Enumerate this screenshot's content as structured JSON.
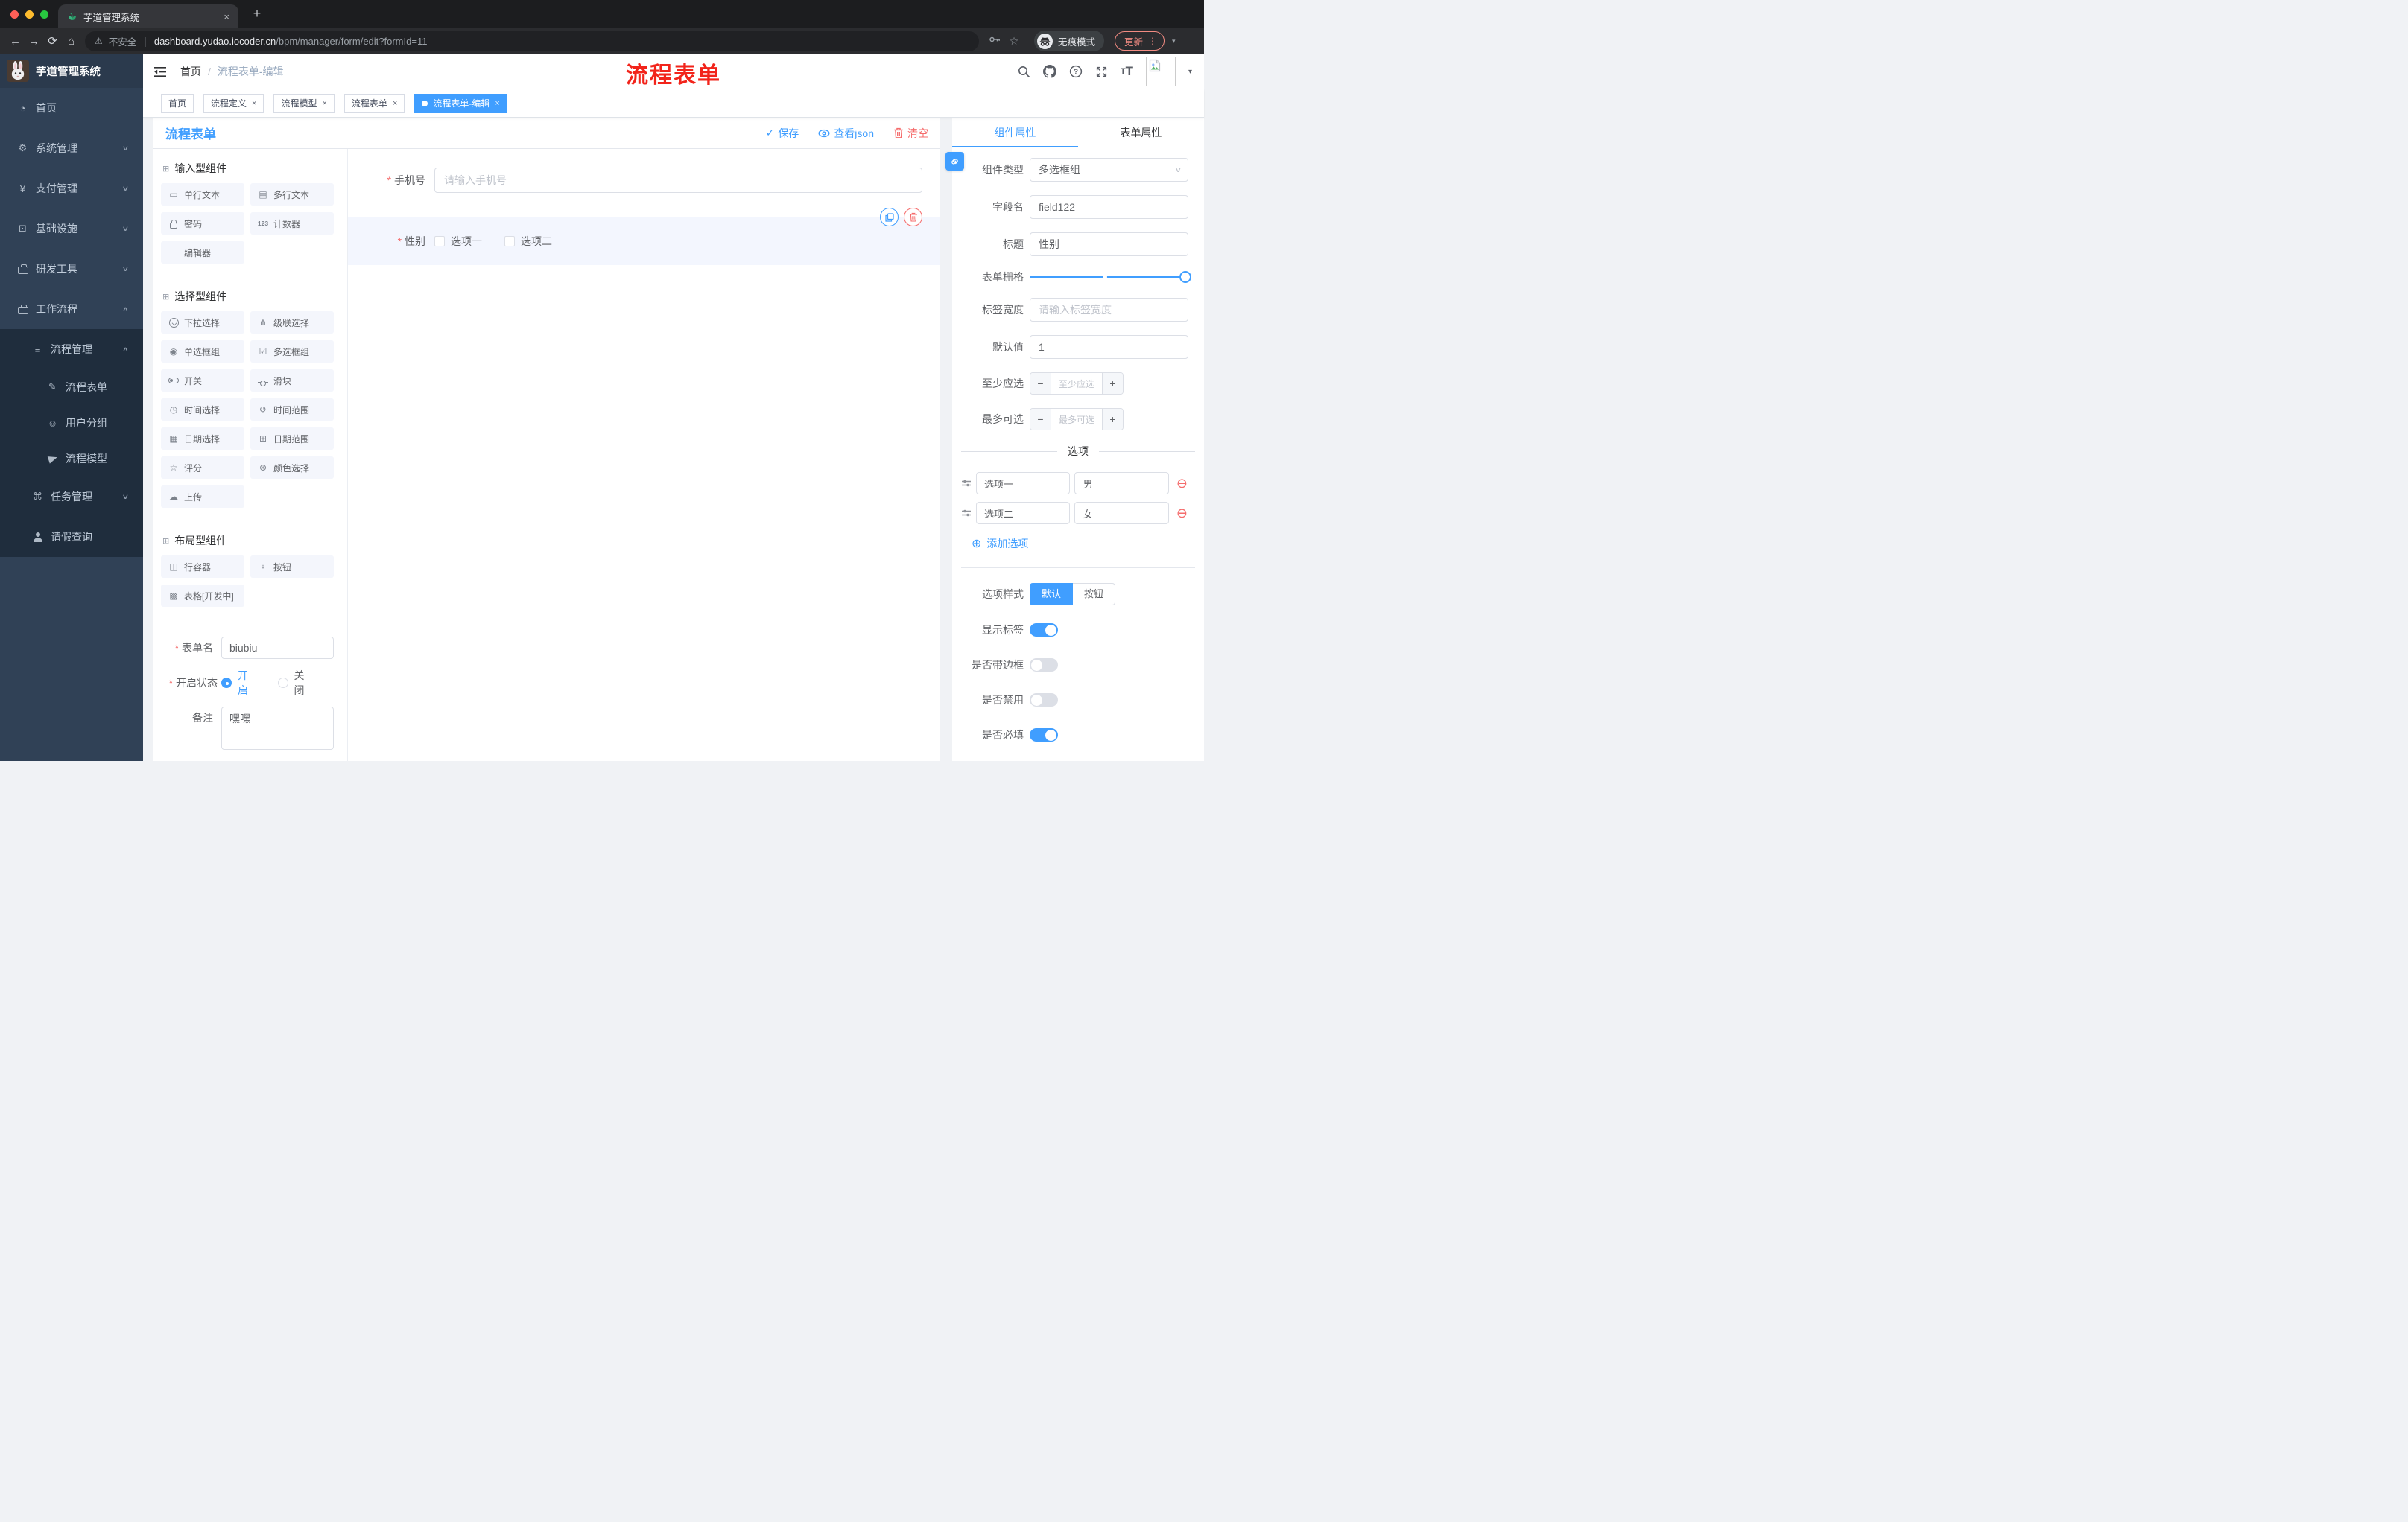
{
  "colors": {
    "accent": "#409eff",
    "danger": "#f56c6c",
    "annotation": "#f2241b",
    "active_tab_bg": "#409eff"
  },
  "browser": {
    "tab_title": "芋道管理系统",
    "close_glyph": "×",
    "new_tab_glyph": "+",
    "back_glyph": "←",
    "forward_glyph": "→",
    "reload_glyph": "⟳",
    "home_glyph": "⌂",
    "security_label": "不安全",
    "url_domain": "dashboard.yudao.iocoder.cn",
    "url_path": "/bpm/manager/form/edit?formId=11",
    "incognito_label": "无痕模式",
    "update_label": "更新",
    "menu_dots": "⋮",
    "caret_glyph": "▾"
  },
  "sidebar": {
    "logo_title": "芋道管理系统",
    "menu": [
      {
        "icon": "dashboard-icon",
        "glyph": "◔",
        "label": "首页",
        "chevron": "",
        "level": 1,
        "dark": false
      },
      {
        "icon": "gear-icon",
        "glyph": "⚙",
        "label": "系统管理",
        "chevron": "down",
        "level": 1,
        "dark": false
      },
      {
        "icon": "yen-icon",
        "glyph": "¥",
        "label": "支付管理",
        "chevron": "down",
        "level": 1,
        "dark": false
      },
      {
        "icon": "infra-icon",
        "glyph": "⊡",
        "label": "基础设施",
        "chevron": "down",
        "level": 1,
        "dark": false
      },
      {
        "icon": "toolbox-icon",
        "glyph": "css:i-brief",
        "label": "研发工具",
        "chevron": "down",
        "level": 1,
        "dark": false
      },
      {
        "icon": "workflow-icon",
        "glyph": "css:i-brief",
        "label": "工作流程",
        "chevron": "up",
        "level": 1,
        "dark": false
      },
      {
        "icon": "process-list-icon",
        "glyph": "≡",
        "label": "流程管理",
        "chevron": "up",
        "level": 2,
        "dark": true
      },
      {
        "icon": "form-doc-icon",
        "glyph": "✎",
        "label": "流程表单",
        "chevron": "",
        "level": 3,
        "dark": true
      },
      {
        "icon": "user-group-icon",
        "glyph": "☺",
        "label": "用户分组",
        "chevron": "",
        "level": 3,
        "dark": true
      },
      {
        "icon": "paper-plane-icon",
        "glyph": "css:i-plane",
        "label": "流程模型",
        "chevron": "",
        "level": 3,
        "dark": true
      },
      {
        "icon": "task-tree-icon",
        "glyph": "⌘",
        "label": "任务管理",
        "chevron": "down",
        "level": 2,
        "dark": true
      },
      {
        "icon": "person-icon",
        "glyph": "css:i-person",
        "label": "请假查询",
        "chevron": "",
        "level": 2,
        "dark": true
      }
    ]
  },
  "header": {
    "breadcrumb_home": "首页",
    "breadcrumb_sep": "/",
    "breadcrumb_current": "流程表单-编辑",
    "annotation": "流程表单",
    "text_size_small": "T",
    "text_size_big": "T",
    "caret_glyph": "▾"
  },
  "tagbar": {
    "tabs": [
      {
        "label": "首页",
        "closable": false,
        "active": false
      },
      {
        "label": "流程定义",
        "closable": true,
        "active": false
      },
      {
        "label": "流程模型",
        "closable": true,
        "active": false
      },
      {
        "label": "流程表单",
        "closable": true,
        "active": false
      },
      {
        "label": "流程表单-编辑",
        "closable": true,
        "active": true
      }
    ],
    "close_glyph": "×"
  },
  "toolbar": {
    "title": "流程表单",
    "save_label": "保存",
    "save_check": "✓",
    "view_json_label": "查看json",
    "clear_label": "清空"
  },
  "library": {
    "sections": [
      {
        "title": "输入型组件",
        "items": [
          {
            "icon": "textfield-icon",
            "glyph": "▭",
            "label": "单行文本"
          },
          {
            "icon": "textarea-icon",
            "glyph": "▤",
            "label": "多行文本"
          },
          {
            "icon": "lock-icon",
            "glyph": "css:i-lock",
            "label": "密码"
          },
          {
            "icon": "counter-icon",
            "glyph": "txt:123",
            "label": "计数器"
          },
          {
            "icon": "",
            "glyph": "",
            "label": "编辑器"
          }
        ]
      },
      {
        "title": "选择型组件",
        "items": [
          {
            "icon": "select-icon",
            "glyph": "css:i-circlechev",
            "label": "下拉选择"
          },
          {
            "icon": "cascade-icon",
            "glyph": "⋔",
            "label": "级联选择"
          },
          {
            "icon": "radio-group-icon",
            "glyph": "◉",
            "label": "单选框组"
          },
          {
            "icon": "checkbox-group-icon",
            "glyph": "☑",
            "label": "多选框组"
          },
          {
            "icon": "switch-icon",
            "glyph": "css:i-toggle",
            "label": "开关"
          },
          {
            "icon": "slider-icon",
            "glyph": "css:i-slider",
            "label": "滑块"
          },
          {
            "icon": "time-icon",
            "glyph": "◷",
            "label": "时间选择"
          },
          {
            "icon": "time-range-icon",
            "glyph": "↺",
            "label": "时间范围"
          },
          {
            "icon": "date-icon",
            "glyph": "▦",
            "label": "日期选择"
          },
          {
            "icon": "date-range-icon",
            "glyph": "⊞",
            "label": "日期范围"
          },
          {
            "icon": "rate-icon",
            "glyph": "☆",
            "label": "评分"
          },
          {
            "icon": "color-icon",
            "glyph": "⊛",
            "label": "颜色选择"
          },
          {
            "icon": "upload-icon",
            "glyph": "☁",
            "label": "上传"
          }
        ]
      },
      {
        "title": "布局型组件",
        "items": [
          {
            "icon": "row-container-icon",
            "glyph": "◫",
            "label": "行容器"
          },
          {
            "icon": "button-icon",
            "glyph": "⌖",
            "label": "按钮"
          },
          {
            "icon": "table-icon",
            "glyph": "▩",
            "label": "表格[开发中]"
          }
        ]
      }
    ],
    "form": {
      "name_label": "表单名",
      "name_value": "biubiu",
      "status_label": "开启状态",
      "status_options": [
        "开启",
        "关闭"
      ],
      "status_selected": "开启",
      "remark_label": "备注",
      "remark_value": "嘿嘿"
    }
  },
  "canvas": {
    "phone_label": "手机号",
    "phone_placeholder": "请输入手机号",
    "gender_label": "性别",
    "gender_options": [
      "选项一",
      "选项二"
    ]
  },
  "props": {
    "tab_component": "组件属性",
    "tab_form": "表单属性",
    "type_label": "组件类型",
    "type_value": "多选框组",
    "field_label": "字段名",
    "field_value": "field122",
    "title_label": "标题",
    "title_value": "性别",
    "grid_label": "表单栅格",
    "label_width_label": "标签宽度",
    "label_width_placeholder": "请输入标签宽度",
    "default_label": "默认值",
    "default_value": "1",
    "min_label": "至少应选",
    "min_placeholder": "至少应选",
    "max_label": "最多可选",
    "max_placeholder": "最多可选",
    "options_title": "选项",
    "options": [
      {
        "label": "选项一",
        "value": "男"
      },
      {
        "label": "选项二",
        "value": "女"
      }
    ],
    "add_option_label": "添加选项",
    "style_label": "选项样式",
    "style_options": [
      "默认",
      "按钮"
    ],
    "style_selected": "默认",
    "switches": [
      {
        "label": "显示标签",
        "on": true
      },
      {
        "label": "是否带边框",
        "on": false
      },
      {
        "label": "是否禁用",
        "on": false
      },
      {
        "label": "是否必填",
        "on": true
      }
    ]
  }
}
